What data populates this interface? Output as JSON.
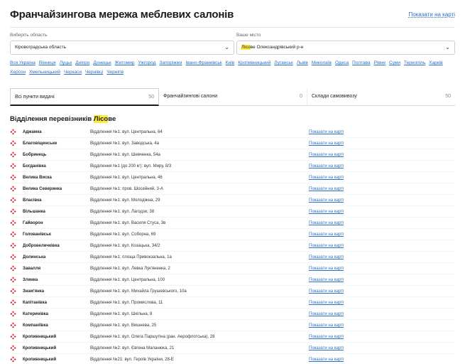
{
  "header": {
    "title": "Франчайзингова мережа меблевих салонів",
    "map_link": "Показати на карті"
  },
  "filters": {
    "region_label": "Виберіть область",
    "region_value": "Кіровоградська область",
    "city_label": "Ваше місто",
    "city_value_highlight": "Лісо",
    "city_value_rest": "ве Олександрівський р-н"
  },
  "cities": [
    "Вся Україна",
    "Вінниця",
    "Луцьк",
    "Дніпро",
    "Донецьк",
    "Житомир",
    "Ужгород",
    "Запоріжжя",
    "Івано-Франківськ",
    "Київ",
    "Кропивницький",
    "Луганськ",
    "Львів",
    "Миколаїв",
    "Одеса",
    "Полтава",
    "Рівне",
    "Суми",
    "Тернопіль",
    "Харків",
    "Херсон",
    "Хмельницький",
    "Черкаси",
    "Чернівці",
    "Чернігів"
  ],
  "tabs": [
    {
      "label": "Всі пункти видачі",
      "count": "50"
    },
    {
      "label": "Франчайзингові салони",
      "count": "0"
    },
    {
      "label": "Склади самовивозу",
      "count": "50"
    }
  ],
  "section": {
    "prefix": "Відділення перевізників ",
    "highlight": "Лісо",
    "suffix": "ве"
  },
  "row_map_label": "Показати на карті",
  "brand_color": "#e3222b",
  "rows": [
    {
      "name": "Аджамка",
      "address": "Відділення №1: вул. Центральна, 64"
    },
    {
      "name": "Благовіщенське",
      "address": "Відділення №1: вул. Заводська, 4а"
    },
    {
      "name": "Бобринець",
      "address": "Відділення №1: вул. Шевченка, 54а"
    },
    {
      "name": "Богданівка",
      "address": "Відділення №1 (до 200 кг): вул. Миру, 8/3"
    },
    {
      "name": "Велика Виска",
      "address": "Відділення №1: вул. Центральна, 46"
    },
    {
      "name": "Велика Северинка",
      "address": "Відділення №1: пров. Шосейний, 3-А"
    },
    {
      "name": "Власівка",
      "address": "Відділення №1: вул. Молодіжна, 29"
    },
    {
      "name": "Вільшанка",
      "address": "Відділення №1: вул. Лагодзи, 38"
    },
    {
      "name": "Гайворон",
      "address": "Відділення №1: вул. Василя Стуса, 3в"
    },
    {
      "name": "Голованівськ",
      "address": "Відділення №1: вул. Соборна, 69"
    },
    {
      "name": "Добровеличківка",
      "address": "Відділення №1: вул. Козацька, 34/2"
    },
    {
      "name": "Долинська",
      "address": "Відділення №1: площа Привокзальна, 1а"
    },
    {
      "name": "Завалля",
      "address": "Відділення №1: вул. Левка Лук'яненка, 2"
    },
    {
      "name": "Злинка",
      "address": "Відділення №1: вул. Центральна, 100"
    },
    {
      "name": "Знам'янка",
      "address": "Відділення №1: вул. Михайла Грушевського, 10а"
    },
    {
      "name": "Капітанівка",
      "address": "Відділення №1: вул. Промислова, 11"
    },
    {
      "name": "Катеринівка",
      "address": "Відділення №1: вул. Шкільна, 8"
    },
    {
      "name": "Компаніївка",
      "address": "Відділення №1: вул. Вишнева, 25"
    },
    {
      "name": "Кропивницький",
      "address": "Відділення №1: вул. Олега Паршутіна (ран. Аерофлотська), 28"
    },
    {
      "name": "Кропивницький",
      "address": "Відділення №2: вул. Євгена Маланюка, 21"
    },
    {
      "name": "Кропивницький",
      "address": "Відділення №21: вул. Героїв України, 28-Е"
    }
  ]
}
